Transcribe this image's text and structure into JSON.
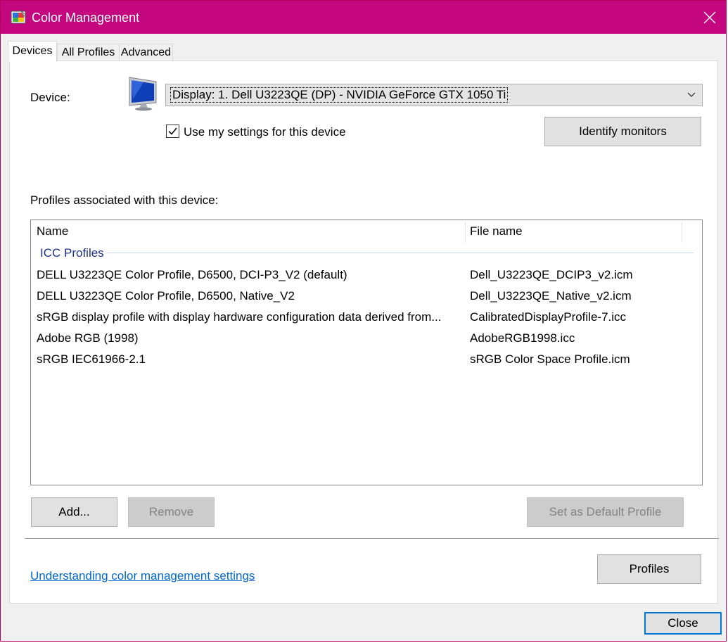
{
  "window": {
    "title": "Color Management"
  },
  "tabs": [
    {
      "label": "Devices"
    },
    {
      "label": "All Profiles"
    },
    {
      "label": "Advanced"
    }
  ],
  "device": {
    "label": "Device:",
    "selected": "Display: 1. Dell U3223QE (DP) - NVIDIA GeForce GTX 1050 Ti",
    "use_settings_label": "Use my settings for this device",
    "use_settings_checked": true,
    "identify_button": "Identify monitors"
  },
  "profiles": {
    "section_label": "Profiles associated with this device:",
    "columns": [
      "Name",
      "File name"
    ],
    "group": "ICC Profiles",
    "rows": [
      {
        "name": "DELL U3223QE Color Profile, D6500, DCI-P3_V2 (default)",
        "file": "Dell_U3223QE_DCIP3_v2.icm"
      },
      {
        "name": "DELL U3223QE Color Profile, D6500, Native_V2",
        "file": "Dell_U3223QE_Native_v2.icm"
      },
      {
        "name": "sRGB display profile with display hardware configuration data derived from...",
        "file": "CalibratedDisplayProfile-7.icc"
      },
      {
        "name": "Adobe RGB (1998)",
        "file": "AdobeRGB1998.icc"
      },
      {
        "name": "sRGB IEC61966-2.1",
        "file": "sRGB Color Space Profile.icm"
      }
    ]
  },
  "buttons": {
    "add": "Add...",
    "remove": "Remove",
    "set_default": "Set as Default Profile",
    "profiles": "Profiles",
    "close": "Close"
  },
  "link": {
    "text": "Understanding color management settings"
  },
  "colors": {
    "titlebar": "#c4077e",
    "link": "#0066cc",
    "group": "#1e3287"
  }
}
